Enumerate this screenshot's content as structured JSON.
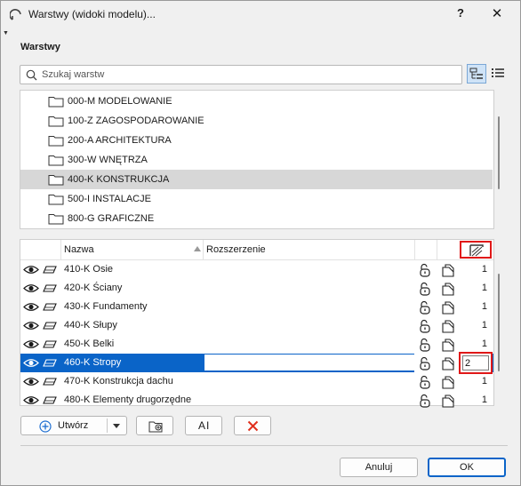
{
  "window": {
    "title": "Warstwy (widoki modelu)...",
    "help": "?",
    "close": "✕"
  },
  "section": {
    "title": "Warstwy"
  },
  "search": {
    "placeholder": "Szukaj warstw",
    "value": ""
  },
  "folders": [
    {
      "label": "000-M MODELOWANIE",
      "selected": false
    },
    {
      "label": "100-Z ZAGOSPODAROWANIE",
      "selected": false
    },
    {
      "label": "200-A ARCHITEKTURA",
      "selected": false
    },
    {
      "label": "300-W WNĘTRZA",
      "selected": false
    },
    {
      "label": "400-K KONSTRUKCJA",
      "selected": true
    },
    {
      "label": "500-I INSTALACJE",
      "selected": false
    },
    {
      "label": "800-G GRAFICZNE",
      "selected": false
    }
  ],
  "table": {
    "headers": {
      "name": "Nazwa",
      "extension": "Rozszerzenie"
    },
    "rows": [
      {
        "name": "410-K Osie",
        "pen": "1",
        "selected": false
      },
      {
        "name": "420-K Ściany",
        "pen": "1",
        "selected": false
      },
      {
        "name": "430-K Fundamenty",
        "pen": "1",
        "selected": false
      },
      {
        "name": "440-K Słupy",
        "pen": "1",
        "selected": false
      },
      {
        "name": "450-K Belki",
        "pen": "1",
        "selected": false
      },
      {
        "name": "460-K Stropy",
        "pen": "2",
        "selected": true
      },
      {
        "name": "470-K Konstrukcja dachu",
        "pen": "1",
        "selected": false
      },
      {
        "name": "480-K Elementy drugorzędne",
        "pen": "1",
        "selected": false
      }
    ]
  },
  "buttons": {
    "create": "Utwórz",
    "rename": "AI",
    "cancel": "Anuluj",
    "ok": "OK"
  },
  "colors": {
    "selection": "#0a64c8",
    "highlight_box": "#e01818",
    "delete_x": "#e0301e",
    "create_plus": "#1f6fd1"
  },
  "icons": {
    "folder": "folder-icon",
    "eye": "eye-icon",
    "plane": "layer-plane-icon",
    "lock": "lock-icon",
    "doc": "document-icon",
    "delete": "delete-x-icon",
    "new_folder": "new-folder-icon"
  }
}
